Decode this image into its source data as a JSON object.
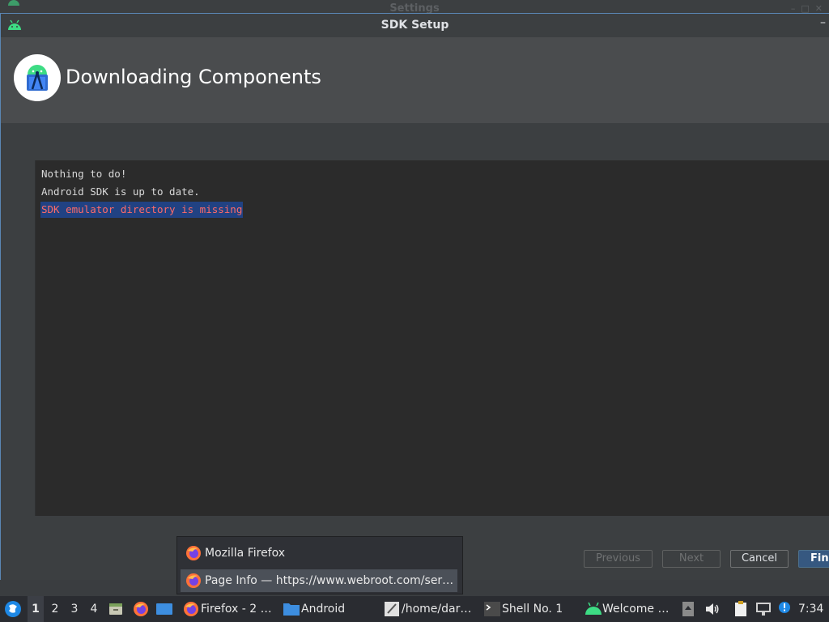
{
  "background_window": {
    "title": "Settings"
  },
  "dialog": {
    "title": "SDK Setup",
    "minimize_glyph": "–",
    "heading": "Downloading Components",
    "console_lines": [
      "Nothing to do!",
      "Android SDK is up to date.",
      "SDK emulator directory is missing"
    ],
    "buttons": {
      "previous": "Previous",
      "next": "Next",
      "cancel": "Cancel",
      "finish": "Fini"
    }
  },
  "popup": {
    "items": [
      {
        "label": "Mozilla Firefox",
        "icon": "firefox-icon"
      },
      {
        "label": "Page Info — https://www.webroot.com/ser…",
        "icon": "firefox-icon"
      }
    ]
  },
  "taskbar": {
    "workspaces": [
      "1",
      "2",
      "3",
      "4"
    ],
    "active_workspace": "1",
    "tasks": [
      {
        "label": "Firefox - 2 …",
        "icon": "firefox-icon"
      },
      {
        "label": "Android",
        "icon": "folder-icon"
      },
      {
        "label": "/home/dar…",
        "icon": "text-editor-icon"
      },
      {
        "label": "Shell No. 1",
        "icon": "terminal-icon"
      },
      {
        "label": "Welcome …",
        "icon": "android-icon"
      }
    ],
    "clock": "7:34"
  },
  "colors": {
    "accent": "#365880",
    "error_text": "#ff6b68",
    "selection": "#214283"
  }
}
